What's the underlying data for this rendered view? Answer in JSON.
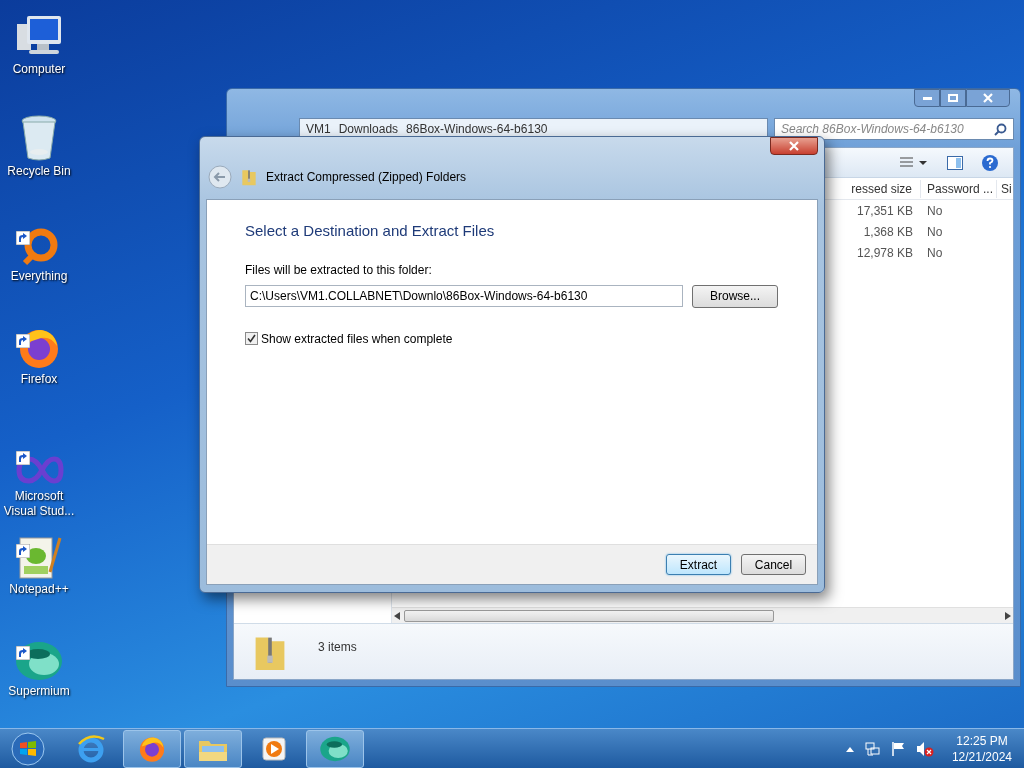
{
  "desktop_icons": [
    {
      "label": "Computer",
      "kind": "computer",
      "shortcut": false
    },
    {
      "label": "Recycle Bin",
      "kind": "bin",
      "shortcut": false
    },
    {
      "label": "Everything",
      "kind": "ring",
      "shortcut": true
    },
    {
      "label": "Firefox",
      "kind": "firefox",
      "shortcut": true
    },
    {
      "label": "Microsoft Visual Stud...",
      "kind": "infinity",
      "shortcut": true
    },
    {
      "label": "Notepad++",
      "kind": "notepad",
      "shortcut": true
    },
    {
      "label": "Supermium",
      "kind": "supermium",
      "shortcut": true
    }
  ],
  "explorer": {
    "address": [
      "VM1",
      "Downloads",
      "86Box-Windows-64-b6130"
    ],
    "search_placeholder": "Search 86Box-Windows-64-b6130",
    "columns": [
      "ressed size",
      "Password ...",
      "Si"
    ],
    "rows": [
      {
        "size": "17,351 KB",
        "password": "No"
      },
      {
        "size": "1,368 KB",
        "password": "No"
      },
      {
        "size": "12,978 KB",
        "password": "No"
      }
    ],
    "status": "3 items"
  },
  "dialog": {
    "title": "Extract Compressed (Zipped) Folders",
    "heading": "Select a Destination and Extract Files",
    "field_label": "Files will be extracted to this folder:",
    "path": "C:\\Users\\VM1.COLLABNET\\Downlo\\86Box-Windows-64-b6130",
    "browse": "Browse...",
    "checkbox": {
      "label": "Show extracted files when complete",
      "checked": true
    },
    "buttons": [
      {
        "label": "Extract",
        "default": true
      },
      {
        "label": "Cancel",
        "default": false
      }
    ]
  },
  "taskbar": {
    "items": [
      {
        "kind": "ie",
        "active": false
      },
      {
        "kind": "firefox",
        "active": true
      },
      {
        "kind": "folder",
        "active": true
      },
      {
        "kind": "media",
        "active": false
      },
      {
        "kind": "supermium",
        "active": true
      }
    ],
    "time": "12:25 PM",
    "date": "12/21/2024"
  }
}
